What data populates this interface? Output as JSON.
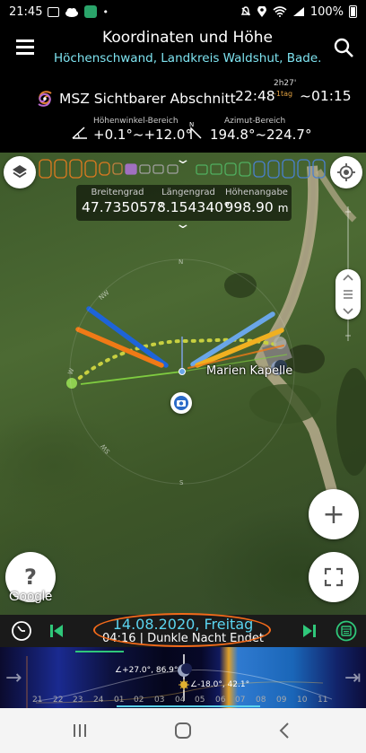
{
  "status_bar": {
    "time": "21:45",
    "battery": "100%"
  },
  "header": {
    "title": "Koordinaten und Höhe",
    "subtitle": "Höchenschwand, Landkreis Waldshut, Bade..."
  },
  "event": {
    "name": "MSZ Sichtbarer Abschnitt",
    "start": "22:48",
    "duration": "2h27'",
    "day_offset": "-1tag",
    "end": "~01:15",
    "elevation_label": "Höhenwinkel-Bereich",
    "elevation_value": "+0.1°~+12.0°",
    "azimuth_label": "Azimut-Bereich",
    "azimuth_value": "194.8°~224.7°"
  },
  "coordinates": {
    "lat_label": "Breitengrad",
    "lat_value": "47.735057°",
    "lon_label": "Längengrad",
    "lon_value": "8.154340°",
    "alt_label": "Höhenangabe",
    "alt_value": "998.90",
    "alt_unit": "m"
  },
  "map": {
    "place_label": "Marien Kapelle",
    "attribution": "Google",
    "compass_labels": [
      "N",
      "NW",
      "W",
      "SW",
      "S"
    ],
    "help_label": "?",
    "zoom_in_label": "+"
  },
  "bottom": {
    "date": "14.08.2020, Freitag",
    "time_event": "04:16 | Dunkle Nacht Endet"
  },
  "timeline": {
    "hours": [
      "21",
      "22",
      "23",
      "24",
      "01",
      "02",
      "03",
      "04",
      "05",
      "06",
      "07",
      "08",
      "09",
      "10",
      "11"
    ],
    "moon_annotation": "∠+27.0°, 86.9°",
    "sun_annotation": "∠-18.0°, 42.1°"
  },
  "colors": {
    "accent_cyan": "#5bd4f0",
    "highlight_orange": "#f26a1a",
    "play_green": "#2fc77a",
    "line_blue": "#1e64d8",
    "line_light_blue": "#6aa6e8",
    "line_orange": "#f07a16",
    "line_yellow": "#f0b020",
    "path_yellow": "#c8d040"
  },
  "icons": [
    "menu-icon",
    "search-icon",
    "layers-icon",
    "my-location-icon",
    "clock-icon",
    "skip-back-icon",
    "skip-forward-icon",
    "calendar-icon",
    "fullscreen-icon",
    "camera-marker-icon"
  ]
}
